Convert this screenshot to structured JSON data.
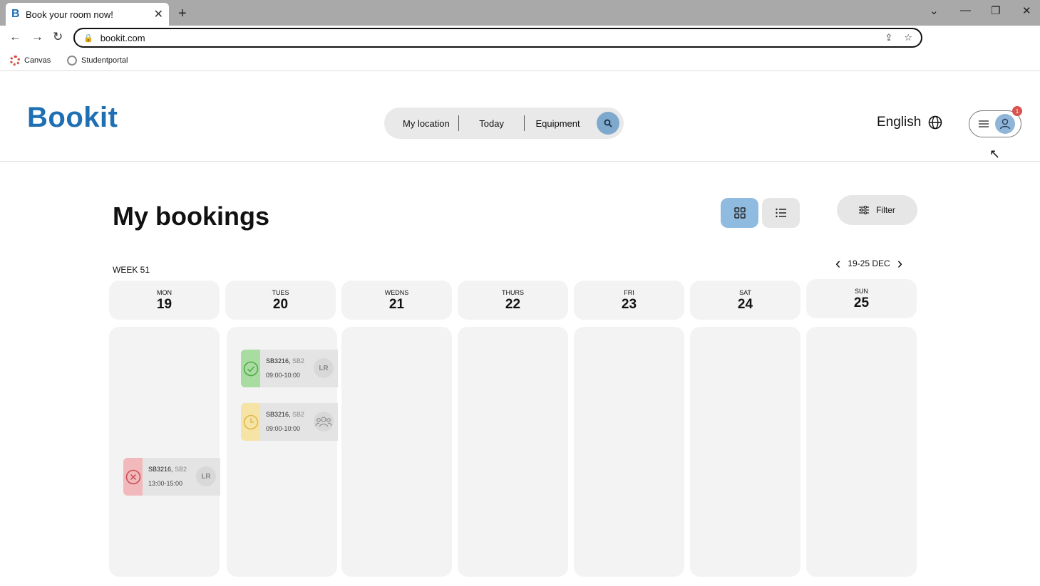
{
  "browser": {
    "tab_title": "Book your room now!",
    "tab_favicon": "B",
    "url": "bookit.com",
    "bookmarks": [
      {
        "label": "Canvas",
        "color": "#d2463a"
      },
      {
        "label": "Studentportal",
        "color": "#8c8c8c"
      }
    ]
  },
  "site": {
    "logo": "Bookit",
    "search": {
      "location": "My location",
      "date": "Today",
      "equipment": "Equipment"
    },
    "language": "English",
    "notification_count": "1"
  },
  "main": {
    "title": "My bookings",
    "filter_label": "Filter",
    "week_label": "WEEK 51",
    "date_range": "19-25 DEC",
    "days": [
      {
        "name": "MON",
        "date": "19"
      },
      {
        "name": "TUES",
        "date": "20"
      },
      {
        "name": "WEDNS",
        "date": "21"
      },
      {
        "name": "THURS",
        "date": "22"
      },
      {
        "name": "FRI",
        "date": "23"
      },
      {
        "name": "SAT",
        "date": "24"
      },
      {
        "name": "SUN",
        "date": "25"
      }
    ],
    "bookings": [
      {
        "room": "SB3216,",
        "building": "SB2",
        "time": "09:00-10:00",
        "status": "confirmed",
        "tag": "LR",
        "status_color": "#a8dca0"
      },
      {
        "room": "SB3216,",
        "building": "SB2",
        "time": "09:00-10:00",
        "status": "pending",
        "tag_icon": "group-icon",
        "status_color": "#f6e3a6"
      },
      {
        "room": "SB3216,",
        "building": "SB2",
        "time": "13:00-15:00",
        "status": "cancelled",
        "tag": "LR",
        "status_color": "#f1b9bb"
      }
    ]
  },
  "colors": {
    "brand": "#1e6fb3",
    "accent": "#8fb5d8",
    "notification": "#d9534f"
  }
}
